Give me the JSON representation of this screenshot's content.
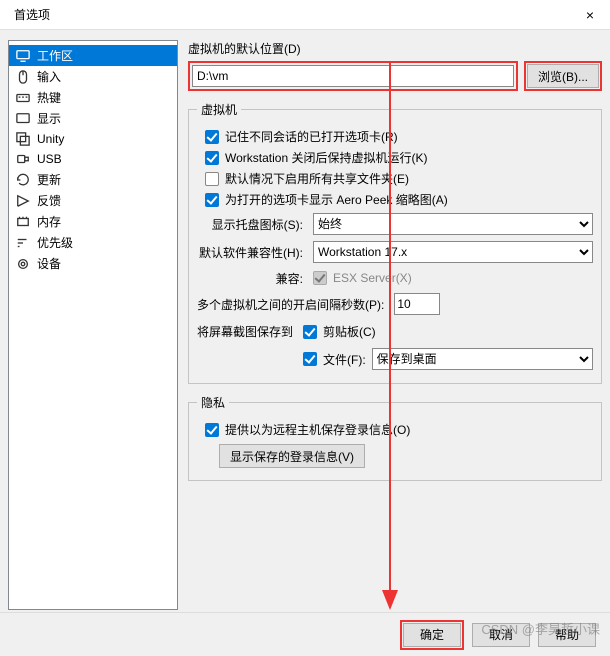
{
  "title": "首选项",
  "sidebar": {
    "items": [
      {
        "label": "工作区"
      },
      {
        "label": "输入"
      },
      {
        "label": "热键"
      },
      {
        "label": "显示"
      },
      {
        "label": "Unity"
      },
      {
        "label": "USB"
      },
      {
        "label": "更新"
      },
      {
        "label": "反馈"
      },
      {
        "label": "内存"
      },
      {
        "label": "优先级"
      },
      {
        "label": "设备"
      }
    ]
  },
  "main": {
    "default_loc_label": "虚拟机的默认位置(D)",
    "default_loc_value": "D:\\vm",
    "browse_label": "浏览(B)...",
    "vm_group": "虚拟机",
    "cb_remember": "记住不同会话的已打开选项卡(R)",
    "cb_keep_running": "Workstation 关闭后保持虚拟机运行(K)",
    "cb_enable_shared": "默认情况下启用所有共享文件夹(E)",
    "cb_aero_peek": "为打开的选项卡显示 Aero Peek 缩略图(A)",
    "tray_label": "显示托盘图标(S):",
    "tray_value": "始终",
    "compat_label": "默认软件兼容性(H):",
    "compat_value": "Workstation 17.x",
    "compat2_label": "兼容:",
    "compat2_cb": "ESX Server(X)",
    "delay_label": "多个虚拟机之间的开启间隔秒数(P):",
    "delay_value": "10",
    "screenshot_label": "将屏幕截图保存到",
    "clipboard_cb": "剪贴板(C)",
    "file_cb": "文件(F):",
    "file_dest_value": "保存到桌面",
    "privacy_group": "隐私",
    "privacy_cb": "提供以为远程主机保存登录信息(O)",
    "show_saved_btn": "显示保存的登录信息(V)"
  },
  "footer": {
    "ok": "确定",
    "cancel": "取消",
    "help": "帮助"
  },
  "watermark": "CSDN @李昊哲小课"
}
